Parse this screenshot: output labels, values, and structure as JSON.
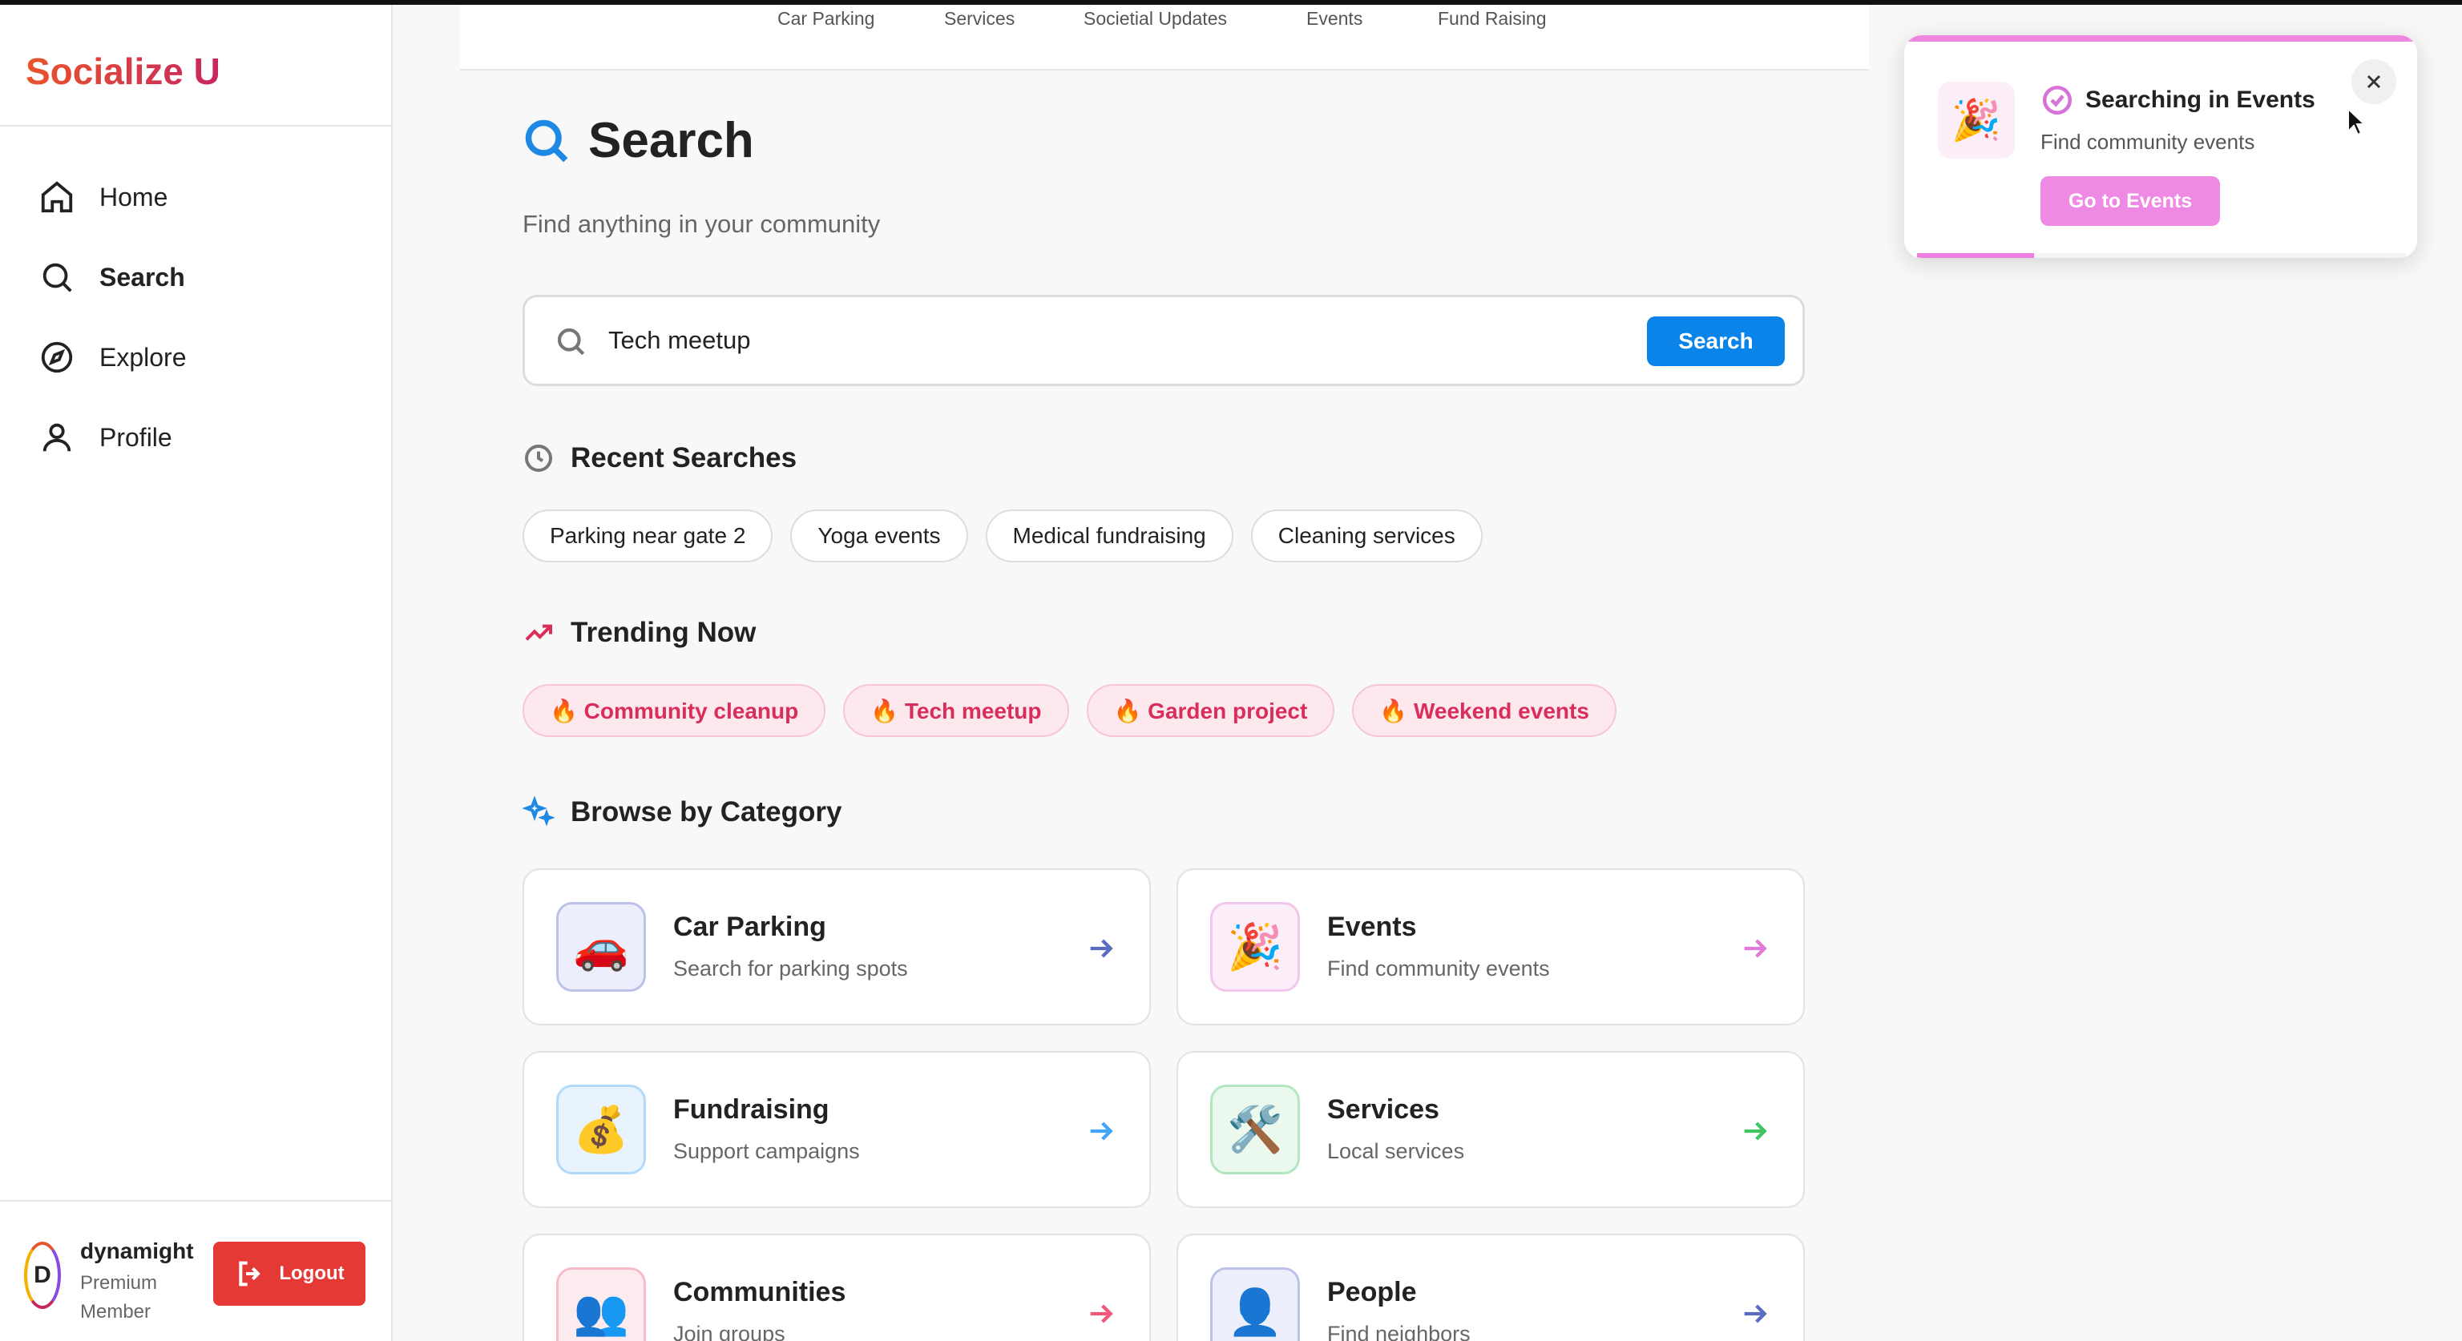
{
  "app": {
    "brand": "Socialize U"
  },
  "top_tabs": [
    "Car Parking",
    "Services",
    "Societial Updates",
    "Events",
    "Fund Raising"
  ],
  "sidebar": {
    "items": [
      {
        "label": "Home",
        "icon": "home-icon"
      },
      {
        "label": "Search",
        "icon": "search-icon",
        "active": true
      },
      {
        "label": "Explore",
        "icon": "compass-icon"
      },
      {
        "label": "Profile",
        "icon": "user-icon"
      }
    ],
    "user": {
      "initial": "D",
      "name": "dynamight",
      "role": "Premium Member"
    },
    "logout_label": "Logout"
  },
  "main": {
    "title": "Search",
    "subtitle": "Find anything in your community",
    "search": {
      "value": "Tech meetup",
      "button_label": "Search"
    },
    "recent": {
      "heading": "Recent Searches",
      "items": [
        "Parking near gate 2",
        "Yoga events",
        "Medical fundraising",
        "Cleaning services"
      ]
    },
    "trending": {
      "heading": "Trending Now",
      "items": [
        "🔥 Community cleanup",
        "🔥 Tech meetup",
        "🔥 Garden project",
        "🔥 Weekend events"
      ]
    },
    "categories": {
      "heading": "Browse by Category",
      "items": [
        {
          "title": "Car Parking",
          "subtitle": "Search for parking spots",
          "emoji": "🚗",
          "accent": "#5c6bc0",
          "bg": "#eceefb"
        },
        {
          "title": "Events",
          "subtitle": "Find community events",
          "emoji": "🎉",
          "accent": "#e07ad8",
          "bg": "#fbeef8"
        },
        {
          "title": "Fundraising",
          "subtitle": "Support campaigns",
          "emoji": "💰",
          "accent": "#42a5f5",
          "bg": "#e8f3fd"
        },
        {
          "title": "Services",
          "subtitle": "Local services",
          "emoji": "🛠️",
          "accent": "#43c463",
          "bg": "#eaf8ee"
        },
        {
          "title": "Communities",
          "subtitle": "Join groups",
          "emoji": "👥",
          "accent": "#ec5a7a",
          "bg": "#fdecef"
        },
        {
          "title": "People",
          "subtitle": "Find neighbors",
          "emoji": "👤",
          "accent": "#5c6bc0",
          "bg": "#eceefb"
        }
      ]
    }
  },
  "toast": {
    "emoji": "🎉",
    "title": "Searching in Events",
    "subtitle": "Find community events",
    "button_label": "Go to Events",
    "progress_fraction": 0.24
  }
}
